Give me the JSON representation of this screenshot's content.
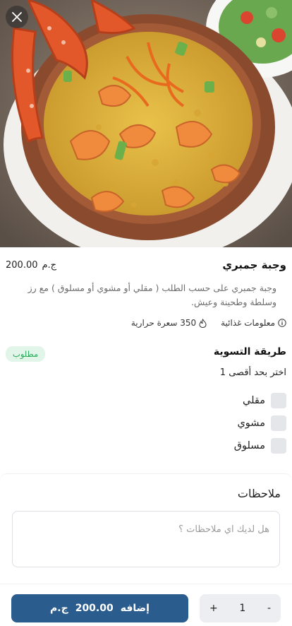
{
  "hero": {
    "image_alt_icon": "dish-photo"
  },
  "close_icon": "close-icon",
  "dish": {
    "title": "وجبة جمبري",
    "price_value": "200.00",
    "currency": "ج.م",
    "description": "وجبة جمبري على حسب الطلب ( مقلي أو مشوي أو مسلوق ) مع رز وسلطة وطحينة وعيش."
  },
  "nutrition": {
    "info_label": "معلومات غذائية",
    "calories_label": "350 سعرة حرارية"
  },
  "cooking_method": {
    "title": "طريقة التسوية",
    "required_badge": "مطلوب",
    "subtitle": "اختر بحد أقصى 1",
    "options": [
      {
        "label": "مقلي",
        "checked": false
      },
      {
        "label": "مشوي",
        "checked": false
      },
      {
        "label": "مسلوق",
        "checked": false
      }
    ]
  },
  "notes": {
    "title": "ملاحظات",
    "placeholder": "هل لديك اي ملاحظات ؟"
  },
  "cart": {
    "add_label": "إضافه",
    "add_price": "200.00",
    "currency": "ج.م",
    "quantity": "1",
    "plus": "+",
    "minus": "-"
  },
  "colors": {
    "primary": "#2b5c8e",
    "required_bg": "#e1f5e8",
    "required_text": "#2aa85a",
    "checkbox_bg": "#e4e6ea"
  }
}
